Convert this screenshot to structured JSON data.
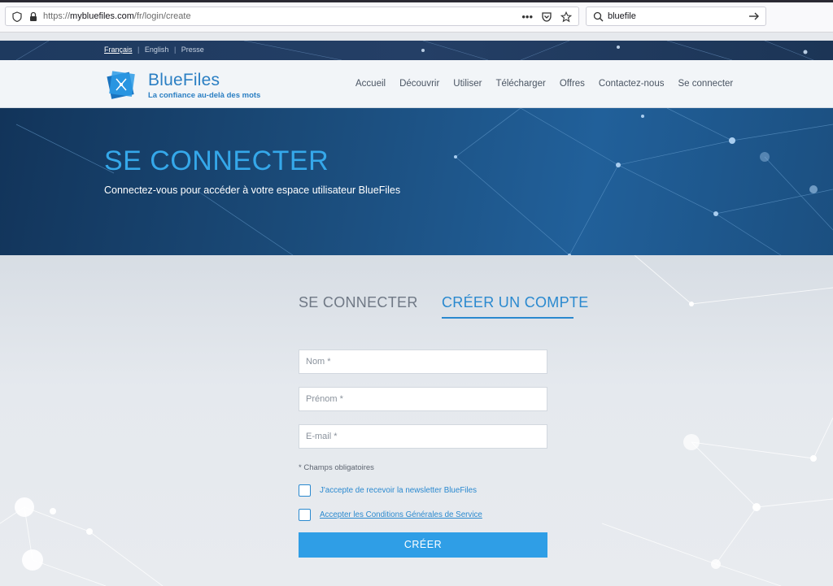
{
  "browser": {
    "url_prefix": "https://",
    "url_host": "mybluefiles.com",
    "url_path": "/fr/login/create",
    "more_glyph": "•••",
    "search_value": "bluefile"
  },
  "site": {
    "languages": [
      {
        "label": "Français",
        "active": true
      },
      {
        "label": "English",
        "active": false
      },
      {
        "label": "Presse",
        "active": false
      }
    ],
    "separator": "|",
    "brand_name": "BlueFiles",
    "brand_tagline": "La confiance au-delà des mots",
    "nav": [
      "Accueil",
      "Découvrir",
      "Utiliser",
      "Télécharger",
      "Offres",
      "Contactez-nous",
      "Se connecter"
    ]
  },
  "hero": {
    "title": "SE CONNECTER",
    "subtitle": "Connectez-vous pour accéder à votre espace utilisateur BlueFiles"
  },
  "form": {
    "tab_login": "SE CONNECTER",
    "tab_create": "CRÉER UN COMPTE",
    "placeholders": {
      "nom": "Nom *",
      "prenom": "Prénom *",
      "email": "E-mail *"
    },
    "required_note": "* Champs obligatoires",
    "newsletter_label": "J'accepte de recevoir la newsletter BlueFiles",
    "cgs_label": "Accepter les Conditions Générales de Service",
    "submit_label": "CRÉER"
  },
  "colors": {
    "accent": "#2a89cf",
    "button": "#2f9ee6",
    "hero_title": "#35a8ea"
  }
}
